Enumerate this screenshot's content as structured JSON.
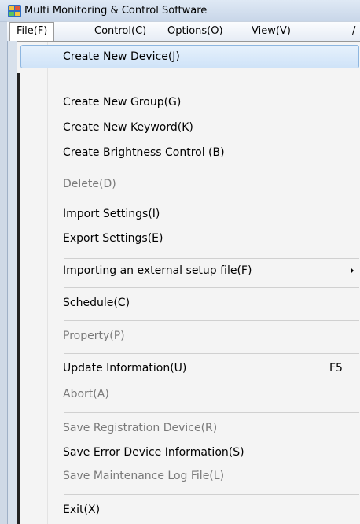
{
  "window": {
    "title": "Multi Monitoring & Control Software"
  },
  "menubar": {
    "items": [
      {
        "label": "File(F)"
      },
      {
        "label": "Control(C)"
      },
      {
        "label": "Options(O)"
      },
      {
        "label": "View(V)"
      },
      {
        "label": "/"
      }
    ]
  },
  "file_menu": {
    "items": [
      {
        "label": "Create New Device(J)",
        "enabled": true,
        "highlighted": true
      },
      {
        "label": "Create New Group(G)",
        "enabled": true
      },
      {
        "label": "Create New Keyword(K)",
        "enabled": true
      },
      {
        "label": "Create Brightness Control (B)",
        "enabled": true
      },
      {
        "label": "Delete(D)",
        "enabled": false
      },
      {
        "label": "Import Settings(I)",
        "enabled": true
      },
      {
        "label": "Export Settings(E)",
        "enabled": true
      },
      {
        "label": "Importing an external setup file(F)",
        "enabled": true,
        "submenu": true
      },
      {
        "label": "Schedule(C)",
        "enabled": true
      },
      {
        "label": "Property(P)",
        "enabled": false
      },
      {
        "label": "Update Information(U)",
        "enabled": true,
        "shortcut": "F5"
      },
      {
        "label": "Abort(A)",
        "enabled": false
      },
      {
        "label": "Save Registration Device(R)",
        "enabled": false
      },
      {
        "label": "Save Error Device Information(S)",
        "enabled": true
      },
      {
        "label": "Save Maintenance Log File(L)",
        "enabled": false
      },
      {
        "label": "Exit(X)",
        "enabled": true
      }
    ]
  },
  "icons": {
    "app": "app-monitor-icon",
    "submenu": "submenu-arrow-icon"
  },
  "colors": {
    "highlight_border": "#8db6e0",
    "highlight_fill": "#cfe3f8",
    "disabled_text": "#7a7a7a",
    "menu_background": "#f4f4f4"
  }
}
